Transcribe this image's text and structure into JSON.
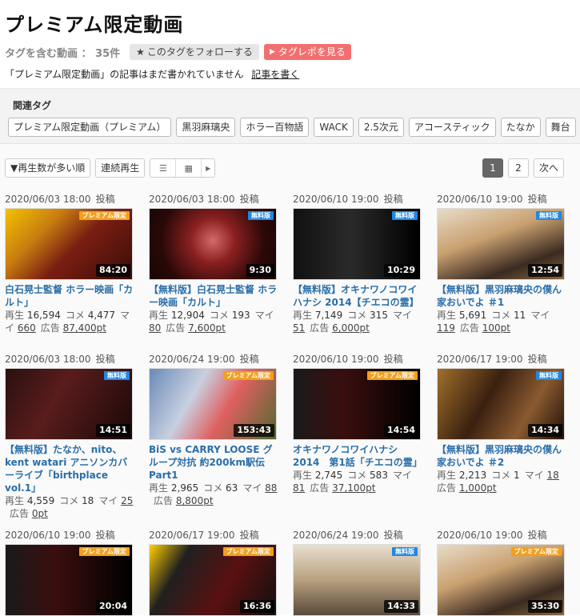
{
  "header": {
    "title": "プレミアム限定動画",
    "count_label": "タグを含む動画 ： 35件",
    "follow_label": "このタグをフォローする",
    "repo_label": "タグレポを見る",
    "notice": "「プレミアム限定動画」の記事はまだ書かれていません",
    "write_link": "記事を書く"
  },
  "related": {
    "title": "関連タグ",
    "tags": [
      "プレミアム限定動画（プレミアム）",
      "黒羽麻璃央",
      "ホラー百物語",
      "WACK",
      "2.5次元",
      "アコースティック",
      "たなか",
      "舞台"
    ]
  },
  "toolbar": {
    "sort_label": "▼再生数が多い順",
    "continuous_label": "連続再生",
    "pages": [
      "1",
      "2"
    ],
    "next_label": "次へ"
  },
  "labels": {
    "post": "投稿",
    "views": "再生",
    "comments": "コメ",
    "mylist": "マイ",
    "ads": "広告"
  },
  "colors": {
    "premium_badge": "#f0a020",
    "free_badge": "#1e88e5",
    "title_link": "#2a6ea8",
    "repo_button": "#f36f6f"
  },
  "videos": [
    {
      "date": "2020/06/03 18:00",
      "badge": "プレミアム限定",
      "badge_type": "prem",
      "duration": "84:20",
      "title": "白石晃士監督 ホラー映画「カルト」",
      "views": "16,594",
      "comments": "4,477",
      "mylist": "660",
      "ads": "87,400pt"
    },
    {
      "date": "2020/06/03 18:00",
      "badge": "無料版",
      "badge_type": "free",
      "duration": "9:30",
      "title": "【無料版】白石晃士監督 ホラー映画「カルト」",
      "views": "12,904",
      "comments": "193",
      "mylist": "80",
      "ads": "7,600pt"
    },
    {
      "date": "2020/06/10 19:00",
      "badge": "無料版",
      "badge_type": "free",
      "duration": "10:29",
      "title": "【無料版】オキナワノコワイハナシ 2014【チエコの霊】",
      "views": "7,149",
      "comments": "315",
      "mylist": "51",
      "ads": "6,000pt"
    },
    {
      "date": "2020/06/10 19:00",
      "badge": "無料版",
      "badge_type": "free",
      "duration": "12:54",
      "title": "【無料版】黒羽麻璃央の僕ん家おいでよ ＃1",
      "views": "5,691",
      "comments": "11",
      "mylist": "119",
      "ads": "100pt"
    },
    {
      "date": "2020/06/03 18:00",
      "badge": "無料版",
      "badge_type": "free",
      "duration": "14:51",
      "title": "【無料版】たなか、nito、kent watari アニソンカバーライブ「birthplace vol.1」",
      "views": "4,559",
      "comments": "18",
      "mylist": "25",
      "ads": "0pt"
    },
    {
      "date": "2020/06/24 19:00",
      "badge": "プレミアム限定",
      "badge_type": "prem",
      "duration": "153:43",
      "title": "BiS vs CARRY LOOSE グループ対抗 約200km駅伝 Part1",
      "views": "2,965",
      "comments": "63",
      "mylist": "88",
      "ads": "8,800pt"
    },
    {
      "date": "2020/06/10 19:00",
      "badge": "プレミアム限定",
      "badge_type": "prem",
      "duration": "14:54",
      "title": "オキナワノコワイハナシ 2014　第1話「チエコの霊」",
      "views": "2,745",
      "comments": "583",
      "mylist": "81",
      "ads": "37,100pt"
    },
    {
      "date": "2020/06/17 19:00",
      "badge": "無料版",
      "badge_type": "free",
      "duration": "14:34",
      "title": "【無料版】黒羽麻璃央の僕ん家おいでよ ＃2",
      "views": "2,213",
      "comments": "1",
      "mylist": "18",
      "ads": "1,000pt"
    },
    {
      "date": "2020/06/10 19:00",
      "badge": "プレミアム限定",
      "badge_type": "prem",
      "duration": "20:04",
      "title": "",
      "views": "",
      "comments": "",
      "mylist": "",
      "ads": ""
    },
    {
      "date": "2020/06/17 19:00",
      "badge": "プレミアム限定",
      "badge_type": "prem",
      "duration": "16:36",
      "title": "",
      "views": "",
      "comments": "",
      "mylist": "",
      "ads": ""
    },
    {
      "date": "2020/06/24 19:00",
      "badge": "無料版",
      "badge_type": "free",
      "duration": "14:33",
      "title": "",
      "views": "",
      "comments": "",
      "mylist": "",
      "ads": ""
    },
    {
      "date": "2020/06/10 19:00",
      "badge": "プレミアム限定",
      "badge_type": "prem",
      "duration": "35:30",
      "title": "",
      "views": "",
      "comments": "",
      "mylist": "",
      "ads": ""
    }
  ]
}
